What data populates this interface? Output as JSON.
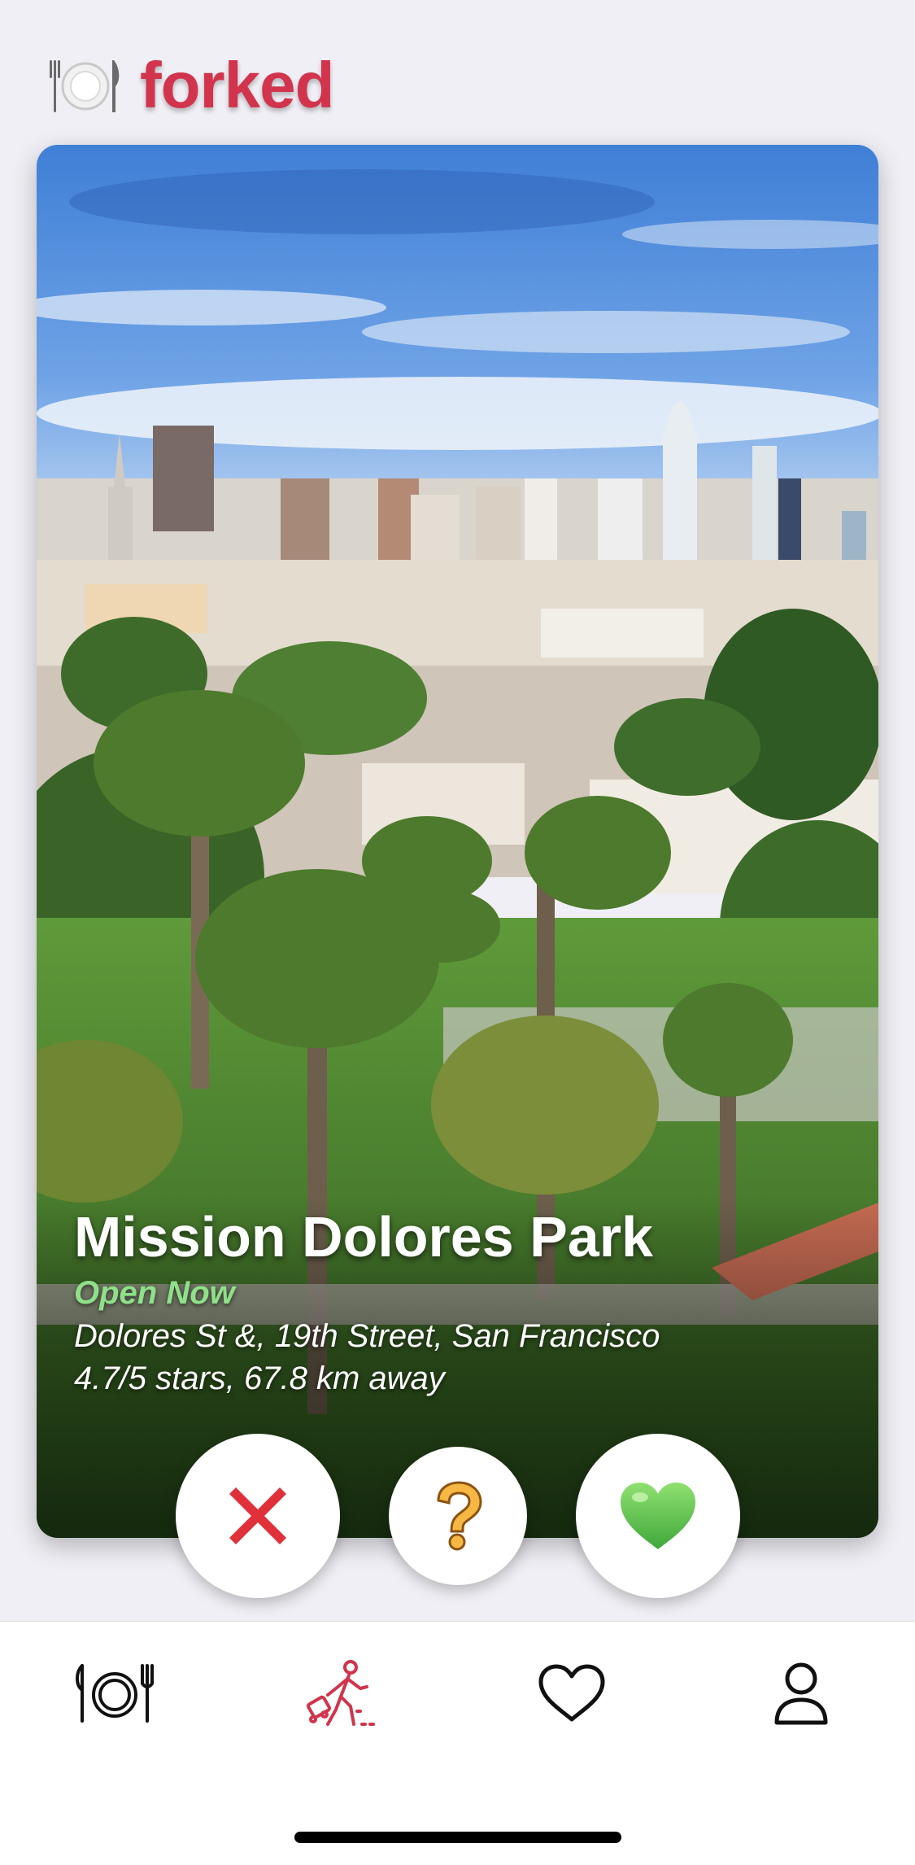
{
  "app": {
    "brand_name": "forked",
    "brand_color": "#d1344c",
    "logo_icon": "plate-fork-knife-icon"
  },
  "card": {
    "place_name": "Mission Dolores Park",
    "open_status": "Open Now",
    "open_status_color": "#8fe088",
    "address": "Dolores St &, 19th Street, San Francisco",
    "rating_distance": "4.7/5 stars, 67.8 km away",
    "photo_subject": "city skyline over park with palm trees"
  },
  "actions": [
    {
      "name": "nope",
      "icon": "red-x-icon"
    },
    {
      "name": "maybe",
      "icon": "question-mark-icon"
    },
    {
      "name": "like",
      "icon": "green-heart-icon"
    }
  ],
  "tabs": [
    {
      "name": "dining",
      "icon": "plate-fork-knife-icon",
      "active": false
    },
    {
      "name": "explore",
      "icon": "traveler-walking-icon",
      "active": true
    },
    {
      "name": "saved",
      "icon": "heart-outline-icon",
      "active": false
    },
    {
      "name": "profile",
      "icon": "person-icon",
      "active": false
    }
  ],
  "colors": {
    "active_tab": "#d1344c",
    "inactive_tab": "#111111",
    "background": "#efeff5"
  }
}
